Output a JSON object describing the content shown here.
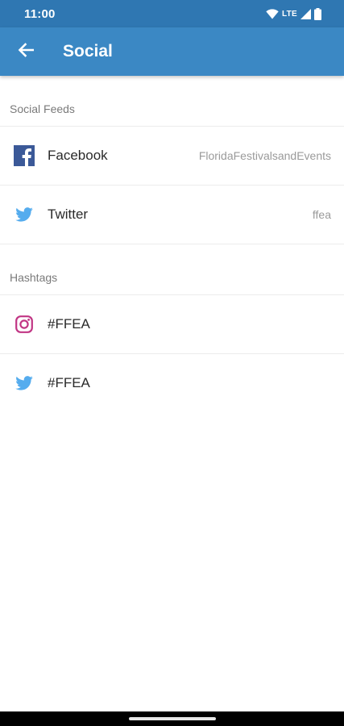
{
  "status_bar": {
    "time": "11:00",
    "network": "LTE",
    "icons": [
      "wifi-icon",
      "signal-icon",
      "battery-icon"
    ]
  },
  "app_bar": {
    "title": "Social",
    "back_icon": "arrow-left-icon"
  },
  "sections": {
    "social_feeds": {
      "header": "Social Feeds",
      "items": [
        {
          "icon": "facebook-icon",
          "label": "Facebook",
          "value": "FloridaFestivalsandEvents"
        },
        {
          "icon": "twitter-icon",
          "label": "Twitter",
          "value": "ffea"
        }
      ]
    },
    "hashtags": {
      "header": "Hashtags",
      "items": [
        {
          "icon": "instagram-icon",
          "label": "#FFEA"
        },
        {
          "icon": "twitter-icon",
          "label": "#FFEA"
        }
      ]
    }
  },
  "colors": {
    "status_bar": "#2f77b2",
    "app_bar": "#3b88c4",
    "facebook": "#3b5998",
    "twitter": "#55acee",
    "instagram": "#c13584"
  }
}
